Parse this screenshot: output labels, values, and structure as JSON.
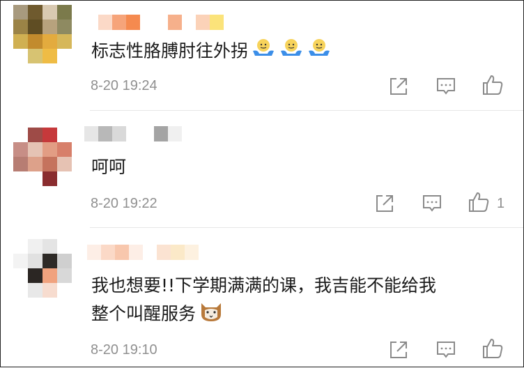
{
  "colors": {
    "text": "#1a1a1a",
    "meta": "#8f8f8f",
    "icon": "#8a8a8a",
    "divider": "#e6e6e6"
  },
  "comments": [
    {
      "text": "标志性胳膊肘往外拐",
      "emoji": [
        "shrug-emoji",
        "shrug-emoji",
        "shrug-emoji"
      ],
      "time": "8-20 19:24",
      "likes": ""
    },
    {
      "text": "呵呵",
      "emoji": [],
      "time": "8-20 19:22",
      "likes": "1"
    },
    {
      "text_line1": "我也想要!!下学期满满的课，我吉能不能给我",
      "text_line2": "整个叫醒服务",
      "emoji": [
        "cat-emoji"
      ],
      "time": "8-20 19:10",
      "likes": ""
    }
  ],
  "icons": {
    "share": "share-icon",
    "comment": "comment-icon",
    "like": "thumbs-up-icon"
  }
}
